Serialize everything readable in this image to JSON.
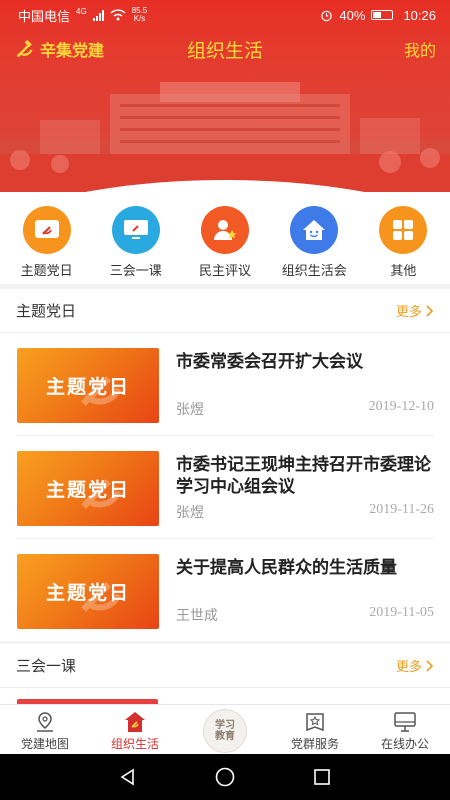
{
  "status_bar": {
    "carrier": "中国电信",
    "network": "4G",
    "speed_value": "85.5",
    "speed_unit": "K/s",
    "battery": "40%",
    "time": "10:26"
  },
  "header": {
    "brand": "辛集党建",
    "title": "组织生活",
    "mine": "我的"
  },
  "quick_nav": [
    {
      "label": "主题党日",
      "icon": "party-flag-icon",
      "color": "#f7941d"
    },
    {
      "label": "三会一课",
      "icon": "monitor-icon",
      "color": "#29a9e0"
    },
    {
      "label": "民主评议",
      "icon": "user-star-icon",
      "color": "#f15a24"
    },
    {
      "label": "组织生活会",
      "icon": "house-smile-icon",
      "color": "#3f7be8"
    },
    {
      "label": "其他",
      "icon": "grid-icon",
      "color": "#f7941d"
    }
  ],
  "section_1": {
    "title": "主题党日",
    "more": "更多",
    "items": [
      {
        "thumb": "主题党日",
        "title": "市委常委会召开扩大会议",
        "author": "张煜",
        "date": "2019-12-10"
      },
      {
        "thumb": "主题党日",
        "title": "市委书记王现坤主持召开市委理论学习中心组会议",
        "author": "张煜",
        "date": "2019-11-26"
      },
      {
        "thumb": "主题党日",
        "title": "关于提高人民群众的生活质量",
        "author": "王世成",
        "date": "2019-11-05"
      }
    ]
  },
  "section_2": {
    "title": "三会一课",
    "more": "更多"
  },
  "tabs": [
    {
      "label": "党建地图",
      "icon": "map-pin-icon",
      "active": false
    },
    {
      "label": "组织生活",
      "icon": "party-house-icon",
      "active": true
    },
    {
      "badge_top": "学习",
      "badge_bottom": "教育",
      "icon": "study-badge-icon",
      "active": false
    },
    {
      "label": "党群服务",
      "icon": "service-star-icon",
      "active": false
    },
    {
      "label": "在线办公",
      "icon": "computer-icon",
      "active": false
    }
  ],
  "colors": {
    "primary_red": "#e53a2e",
    "gold": "#ffd93b",
    "more_orange": "#e8a020",
    "active_tab": "#d32f2f"
  }
}
